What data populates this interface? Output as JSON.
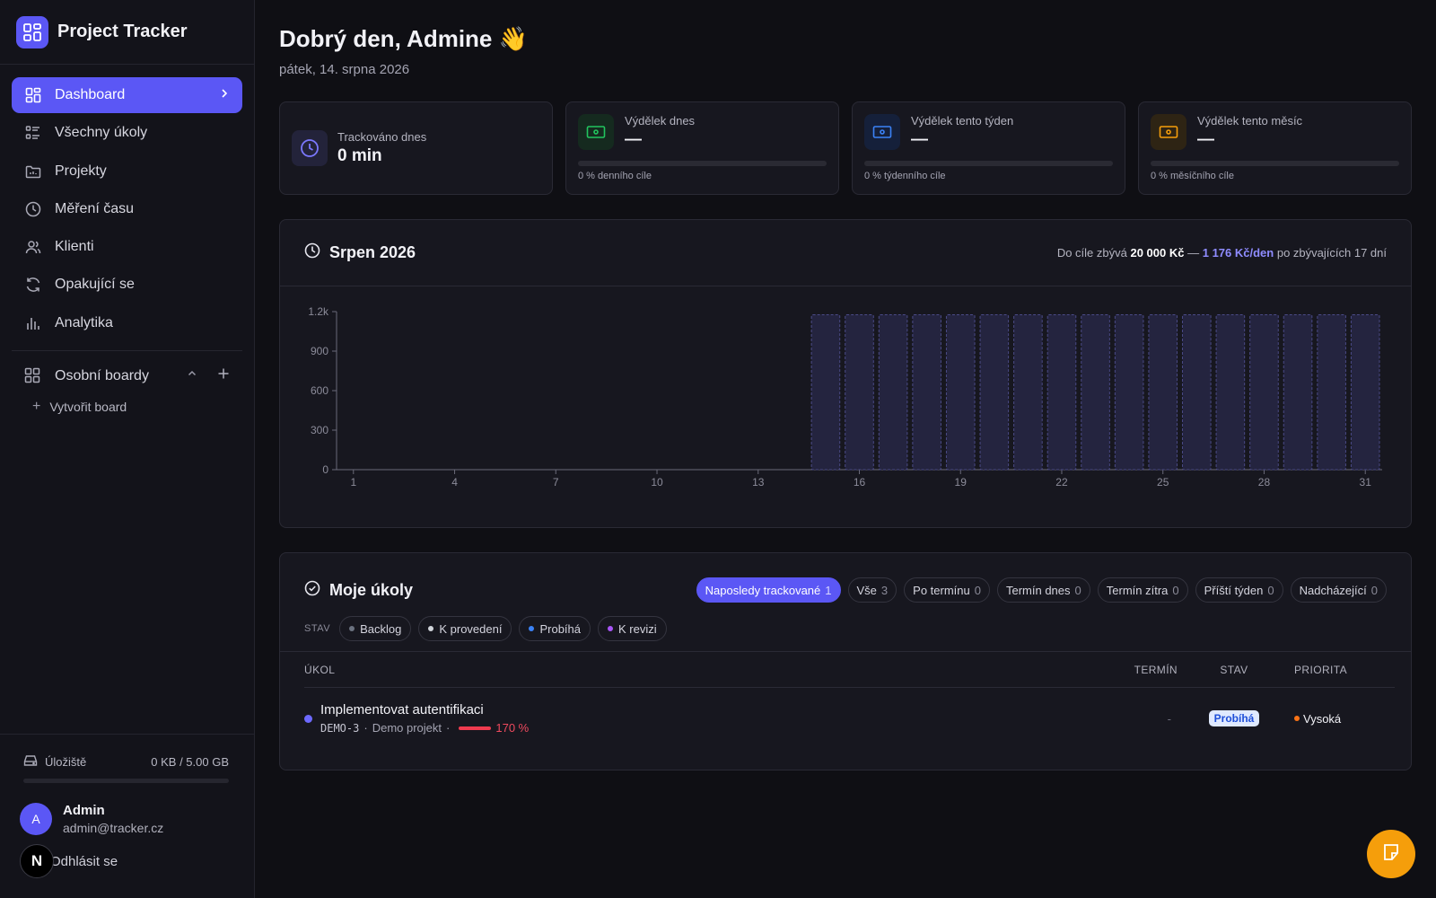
{
  "app": {
    "title": "Project Tracker"
  },
  "sidebar": {
    "items": [
      {
        "label": "Dashboard",
        "icon": "dashboard-icon",
        "active": true
      },
      {
        "label": "Všechny úkoly",
        "icon": "task-list-icon"
      },
      {
        "label": "Projekty",
        "icon": "folder-icon"
      },
      {
        "label": "Měření času",
        "icon": "clock-icon"
      },
      {
        "label": "Klienti",
        "icon": "users-icon"
      },
      {
        "label": "Opakující se",
        "icon": "repeat-icon"
      },
      {
        "label": "Analytika",
        "icon": "bar-chart-icon"
      }
    ],
    "boards": {
      "label": "Osobní boardy",
      "create_label": "Vytvořit board"
    },
    "storage": {
      "label": "Úložiště",
      "value": "0 KB / 5.00 GB",
      "fraction": 0
    },
    "user": {
      "initial": "A",
      "name": "Admin",
      "email": "admin@tracker.cz"
    },
    "logout_label": "Odhlásit se"
  },
  "header": {
    "greeting": "Dobrý den, Admine 👋",
    "date": "pátek, 14. srpna 2026"
  },
  "stats": {
    "tracked": {
      "label": "Trackováno dnes",
      "value": "0 min"
    },
    "earn_day": {
      "label": "Výdělek dnes",
      "value": "—",
      "sub": "0 % denního cíle",
      "progress": 0,
      "color": "#22c55e"
    },
    "earn_week": {
      "label": "Výdělek tento týden",
      "value": "—",
      "sub": "0 % týdenního cíle",
      "progress": 0,
      "color": "#3b82f6"
    },
    "earn_month": {
      "label": "Výdělek tento měsíc",
      "value": "—",
      "sub": "0 % měsíčního cíle",
      "progress": 0,
      "color": "#f59e0b"
    }
  },
  "chart_card": {
    "title": "Srpen 2026",
    "goal": {
      "prefix": "Do cíle zbývá",
      "amount": "20 000 Kč",
      "dash": "—",
      "per_day": "1 176 Kč/den",
      "suffix": "po zbývajících 17 dní"
    }
  },
  "chart_data": {
    "type": "bar",
    "x": [
      1,
      2,
      3,
      4,
      5,
      6,
      7,
      8,
      9,
      10,
      11,
      12,
      13,
      14,
      15,
      16,
      17,
      18,
      19,
      20,
      21,
      22,
      23,
      24,
      25,
      26,
      27,
      28,
      29,
      30,
      31
    ],
    "x_ticks": [
      1,
      4,
      7,
      10,
      13,
      16,
      19,
      22,
      25,
      28,
      31
    ],
    "y_ticks": [
      "0",
      "300",
      "600",
      "900",
      "1.2k"
    ],
    "ylim": [
      0,
      1200
    ],
    "series": [
      {
        "values": [
          0,
          0,
          0,
          0,
          0,
          0,
          0,
          0,
          0,
          0,
          0,
          0,
          0,
          0,
          0,
          0,
          0,
          0,
          0,
          0,
          0,
          0,
          0,
          0,
          0,
          0,
          0,
          0,
          0,
          0,
          0
        ]
      },
      {
        "values": [
          null,
          null,
          null,
          null,
          null,
          null,
          null,
          null,
          null,
          null,
          null,
          null,
          null,
          null,
          1176,
          1176,
          1176,
          1176,
          1176,
          1176,
          1176,
          1176,
          1176,
          1176,
          1176,
          1176,
          1176,
          1176,
          1176,
          1176,
          1176
        ],
        "style": "dashed"
      }
    ]
  },
  "tasks": {
    "title": "Moje úkoly",
    "filters": [
      {
        "label": "Naposledy trackované",
        "count": "1",
        "active": true
      },
      {
        "label": "Vše",
        "count": "3"
      },
      {
        "label": "Po termínu",
        "count": "0"
      },
      {
        "label": "Termín dnes",
        "count": "0"
      },
      {
        "label": "Termín zítra",
        "count": "0"
      },
      {
        "label": "Příští týden",
        "count": "0"
      },
      {
        "label": "Nadcházející",
        "count": "0"
      }
    ],
    "status_label": "STAV",
    "status_filters": [
      {
        "label": "Backlog",
        "color": "#6b7280"
      },
      {
        "label": "K provedení",
        "color": "#d1d5db"
      },
      {
        "label": "Probíhá",
        "color": "#3b82f6"
      },
      {
        "label": "K revizi",
        "color": "#a855f7"
      }
    ],
    "columns": {
      "task": "ÚKOL",
      "term": "TERMÍN",
      "status": "STAV",
      "priority": "PRIORITA"
    },
    "rows": [
      {
        "title": "Implementovat autentifikaci",
        "code": "DEMO-3",
        "project": "Demo projekt",
        "sep": "·",
        "overrun": "170 %",
        "term": "-",
        "status": "Probíhá",
        "priority": "Vysoká",
        "priority_color": "#f97316"
      }
    ]
  }
}
